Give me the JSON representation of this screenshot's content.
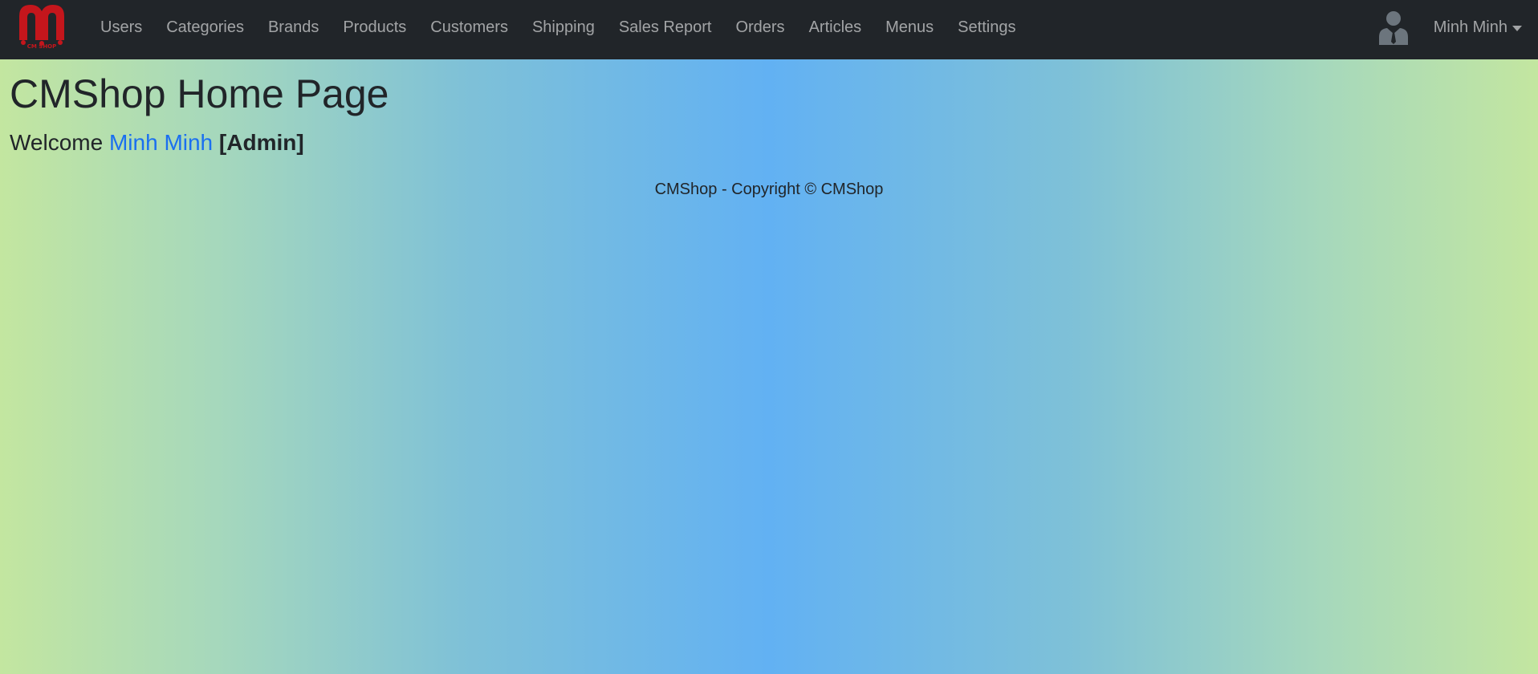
{
  "navbar": {
    "logo_text": "CM SHOP",
    "links": [
      {
        "label": "Users"
      },
      {
        "label": "Categories"
      },
      {
        "label": "Brands"
      },
      {
        "label": "Products"
      },
      {
        "label": "Customers"
      },
      {
        "label": "Shipping"
      },
      {
        "label": "Sales Report"
      },
      {
        "label": "Orders"
      },
      {
        "label": "Articles"
      },
      {
        "label": "Menus"
      },
      {
        "label": "Settings"
      }
    ],
    "user": {
      "icon": "user-icon",
      "name": "Minh Minh"
    }
  },
  "main": {
    "title": "CMShop Home Page",
    "welcome_prefix": "Welcome",
    "user_name": "Minh Minh",
    "role": "[Admin]"
  },
  "footer": {
    "text": "CMShop - Copyright © CMShop"
  },
  "colors": {
    "navbar_bg": "#212529",
    "logo_red": "#c4161c",
    "link_blue": "#1a6ff0",
    "gradient_edge": "#c3e6a0",
    "gradient_center": "#62b1f3"
  }
}
